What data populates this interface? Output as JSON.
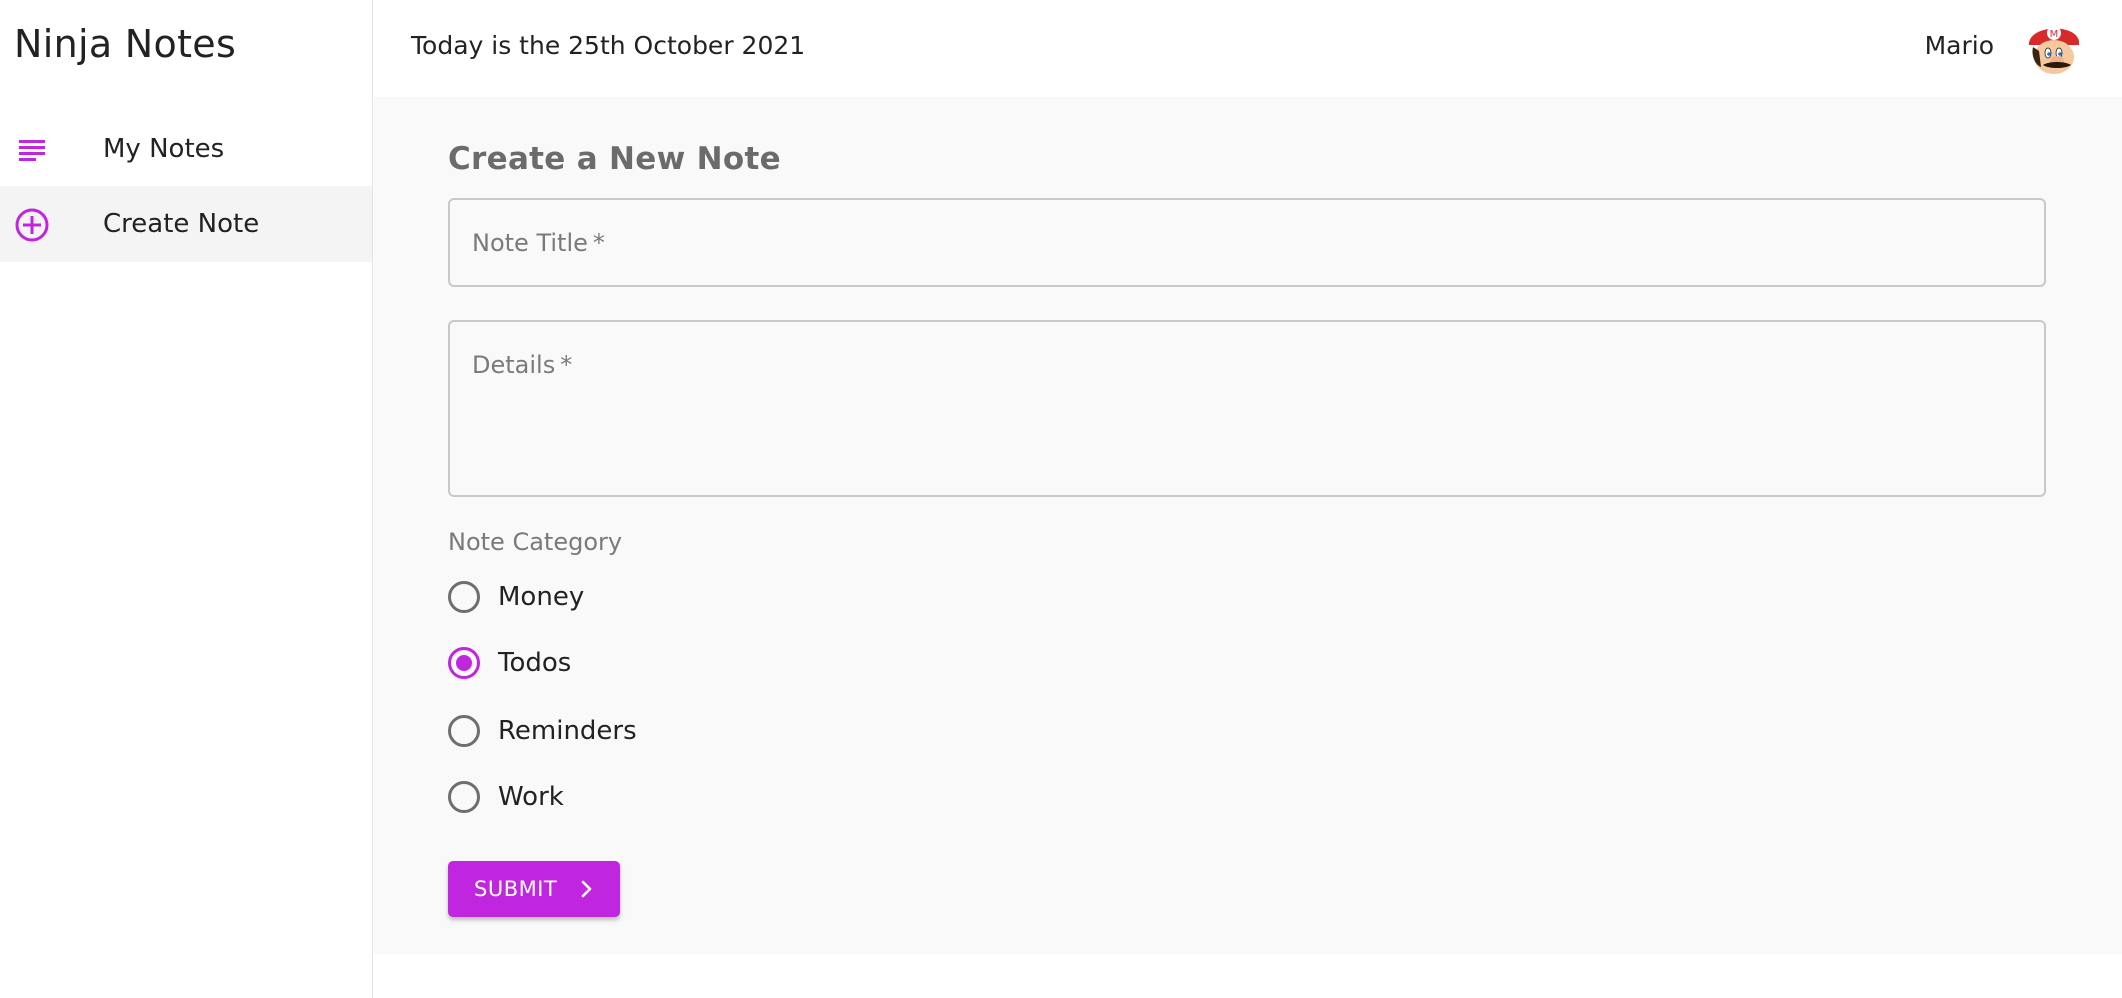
{
  "app": {
    "title": "Ninja Notes"
  },
  "sidebar": {
    "items": [
      {
        "label": "My Notes",
        "icon": "list-icon",
        "active": false
      },
      {
        "label": "Create Note",
        "icon": "add-circle-icon",
        "active": true
      }
    ]
  },
  "header": {
    "date_text": "Today is the 25th October 2021",
    "user_name": "Mario",
    "avatar_icon": "mario-avatar"
  },
  "form": {
    "heading": "Create a New Note",
    "title_placeholder": "Note Title",
    "details_placeholder": "Details",
    "required_mark": "*",
    "category_label": "Note Category",
    "categories": [
      {
        "label": "Money",
        "selected": false
      },
      {
        "label": "Todos",
        "selected": true
      },
      {
        "label": "Reminders",
        "selected": false
      },
      {
        "label": "Work",
        "selected": false
      }
    ],
    "submit_label": "SUBMIT"
  },
  "colors": {
    "accent": "#c026e0",
    "main_background": "#f9f9f9",
    "active_nav_background": "#f4f4f4"
  }
}
